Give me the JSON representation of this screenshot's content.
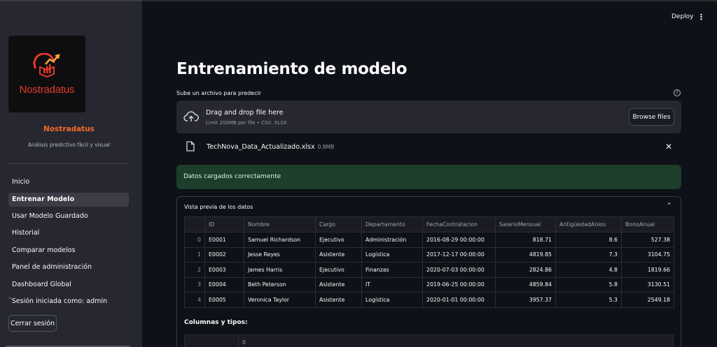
{
  "sidebar": {
    "logo_text": "Nostradatus",
    "brand_name": "Nostradatus",
    "tagline": "Análisis predictivo fácil y visual",
    "nav": [
      {
        "label": "Inicio",
        "active": false
      },
      {
        "label": "Entrenar Modelo",
        "active": true
      },
      {
        "label": "Usar Modelo Guardado",
        "active": false
      },
      {
        "label": "Historial",
        "active": false
      },
      {
        "label": "Comparar modelos",
        "active": false
      },
      {
        "label": "Panel de administración",
        "active": false
      },
      {
        "label": "Dashboard Global",
        "active": false
      }
    ],
    "session_text": "¨Sesión iniciada como: admin",
    "logout_label": "Cerrar sesión"
  },
  "header": {
    "deploy_label": "Deploy",
    "menu_icon": "kebab-menu-icon"
  },
  "main": {
    "title": "Entrenamiento de modelo",
    "upload_label": "Sube un archivo para predecir",
    "dropzone": {
      "title": "Drag and drop file here",
      "subtitle": "Limit 200MB per file • CSV, XLSX",
      "browse_label": "Browse files"
    },
    "file": {
      "name": "TechNova_Data_Actualizado.xlsx",
      "size": "0.8MB"
    },
    "success_message": "Datos cargados correctamente",
    "preview": {
      "title": "Vista previa de los datos",
      "columns": [
        "",
        "ID",
        "Nombre",
        "Cargo",
        "Departamento",
        "FechaContratacion",
        "SalarioMensual",
        "AntigüedadAnios",
        "BonoAnual"
      ],
      "rows": [
        [
          "0",
          "E0001",
          "Samuel Richardson",
          "Ejecutivo",
          "Administración",
          "2016-08-29 00:00:00",
          "818.71",
          "8.6",
          "527.38"
        ],
        [
          "1",
          "E0002",
          "Jesse Reyes",
          "Asistente",
          "Logística",
          "2017-12-17 00:00:00",
          "4819.85",
          "7.3",
          "3104.75"
        ],
        [
          "2",
          "E0003",
          "James Harris",
          "Ejecutivo",
          "Finanzas",
          "2020-07-03 00:00:00",
          "2824.86",
          "4.8",
          "1819.66"
        ],
        [
          "3",
          "E0004",
          "Beth Peterson",
          "Asistente",
          "IT",
          "2019-06-25 00:00:00",
          "4859.84",
          "5.8",
          "3130.51"
        ],
        [
          "4",
          "E0005",
          "Veronica Taylor",
          "Asistente",
          "Logística",
          "2020-01-01 00:00:00",
          "3957.37",
          "5.3",
          "2549.18"
        ]
      ]
    },
    "columns_types": {
      "title": "Columnas y tipos:",
      "header": "0"
    }
  },
  "colors": {
    "sidebar_bg": "#262730",
    "main_bg": "#0e1117",
    "brand_orange": "#f26b2b",
    "logo_red": "#e23a2a",
    "success_bg": "#1c3e2b"
  }
}
